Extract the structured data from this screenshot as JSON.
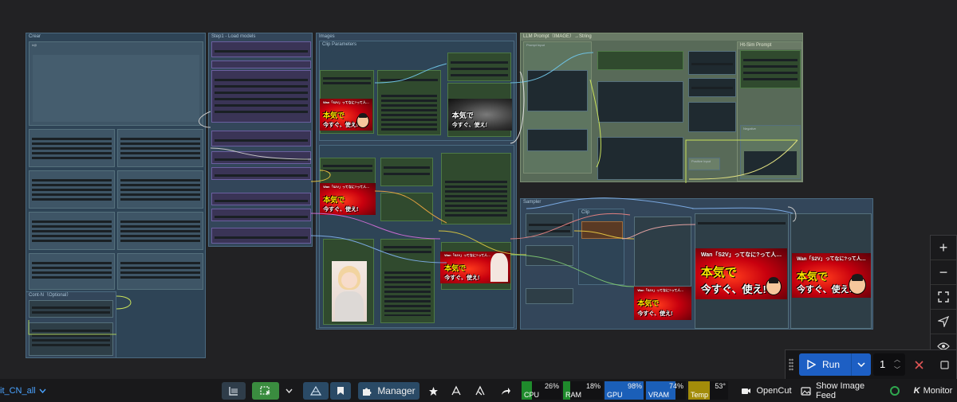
{
  "groups": {
    "g1": "Crear",
    "g1_sub": "#@",
    "g2": "Step1 - Load models",
    "g3": "Images",
    "g3_sub": "Clip Parameters",
    "g4": "LLM Prompt（IMAGE）→String",
    "g4_sub": "Prompt Input",
    "g5": "Ht-Sim Prompt",
    "g5_neg": "Negative",
    "g6": "Cont-N（Optional）",
    "g7": "Sampler",
    "g7_clip": "Clip",
    "inline_positive": "Positive Input"
  },
  "thumbs": {
    "line1": "Wan「S2V」ってなに?って人…",
    "line2": "本気で",
    "line3": "今すぐ、使え!"
  },
  "workflow_tab": "it_CN_all",
  "run": {
    "label": "Run",
    "count": "1"
  },
  "toolbar": {
    "manager_label": "Manager"
  },
  "meters": [
    {
      "label": "CPU",
      "value": "26%",
      "color": "#1f8b2c",
      "level": 0.26
    },
    {
      "label": "RAM",
      "value": "18%",
      "color": "#1f8b2c",
      "level": 0.18
    },
    {
      "label": "GPU",
      "value": "98%",
      "color": "#1b5fb8",
      "level": 0.98
    },
    {
      "label": "VRAM",
      "value": "74%",
      "color": "#1b5fb8",
      "level": 0.74
    },
    {
      "label": "Temp",
      "value": "53°",
      "color": "#a38c0a",
      "level": 0.53
    }
  ],
  "right_items": {
    "opencut": "OpenCut",
    "show_image_feed": "Show Image Feed",
    "monitor": "Monitor"
  },
  "colors": {
    "accent_blue": "#1b5fb8",
    "run_blue": "#1d5fc4",
    "green_button": "#3a8c3f"
  },
  "icons": [
    "plus-icon",
    "minus-icon",
    "fit-view-icon",
    "navigate-icon",
    "eye-icon",
    "play-icon",
    "chevron-down-icon",
    "close-icon",
    "stop-icon",
    "bookmark-icon",
    "star-icon",
    "puzzle-icon",
    "share-icon",
    "camera-icon",
    "image-icon"
  ]
}
